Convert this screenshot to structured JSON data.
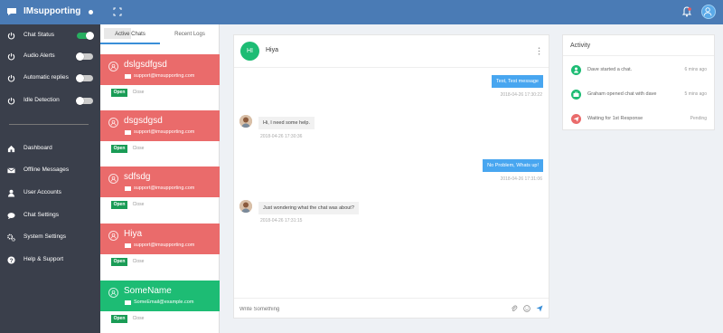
{
  "app": {
    "brand": "IMsupporting"
  },
  "colors": {
    "topbar": "#4a7bb5",
    "sidebar": "#3a3f4b",
    "card_red": "#ea6b6b",
    "card_green": "#1dbc74",
    "accent": "#48a6f0",
    "open_green": "#1a9c56"
  },
  "sidebar": {
    "toggles": [
      {
        "label": "Chat Status",
        "on": true
      },
      {
        "label": "Audio Alerts",
        "on": false
      },
      {
        "label": "Automatic replies",
        "on": false
      },
      {
        "label": "Idle Detection",
        "on": false
      }
    ],
    "nav": [
      {
        "label": "Dashboard",
        "icon": "home-icon"
      },
      {
        "label": "Offline Messages",
        "icon": "envelope-icon"
      },
      {
        "label": "User Accounts",
        "icon": "user-icon"
      },
      {
        "label": "Chat Settings",
        "icon": "chat-bubble-icon"
      },
      {
        "label": "System Settings",
        "icon": "gears-icon"
      },
      {
        "label": "Help & Support",
        "icon": "question-icon"
      }
    ]
  },
  "chatlist": {
    "tabs": [
      "Active Chats",
      "Recent Logs"
    ],
    "chats": [
      {
        "name": "dslgsdfgsd",
        "email": "support@imsupporting.com",
        "status": "red"
      },
      {
        "name": "dsgsdgsd",
        "email": "support@imsupporting.com",
        "status": "red"
      },
      {
        "name": "sdfsdg",
        "email": "support@imsupporting.com",
        "status": "red"
      },
      {
        "name": "Hiya",
        "email": "support@imsupporting.com",
        "status": "red"
      },
      {
        "name": "SomeName",
        "email": "SomeEmail@example.com",
        "status": "green"
      }
    ],
    "open_label": "Open",
    "close_label": "Close"
  },
  "chat": {
    "avatar_initials": "HI",
    "name": "Hiya",
    "messages": [
      {
        "dir": "out",
        "text": "Test, Test message",
        "time": "2018-04-26 17:30:22"
      },
      {
        "dir": "in",
        "text": "Hi, I need some help.",
        "time": "2018-04-26 17:30:36"
      },
      {
        "dir": "out",
        "text": "No Problem, Whats up!",
        "time": "2018-04-26 17:31:06"
      },
      {
        "dir": "in",
        "text": "Just wondering what the chat was about?",
        "time": "2018-04-26 17:31:15"
      }
    ],
    "composer_placeholder": "Write Something"
  },
  "activity": {
    "title": "Activity",
    "items": [
      {
        "text": "Dave started a chat.",
        "time": "6 mins ago",
        "color": "#1dbc74",
        "icon": "user-icon"
      },
      {
        "text": "Graham opened chat with dave",
        "time": "5 mins ago",
        "color": "#1dbc74",
        "icon": "briefcase-icon"
      },
      {
        "text": "Waiting for 1st Response",
        "time": "Pending",
        "color": "#ea6b6b",
        "icon": "paper-plane-icon"
      }
    ]
  }
}
